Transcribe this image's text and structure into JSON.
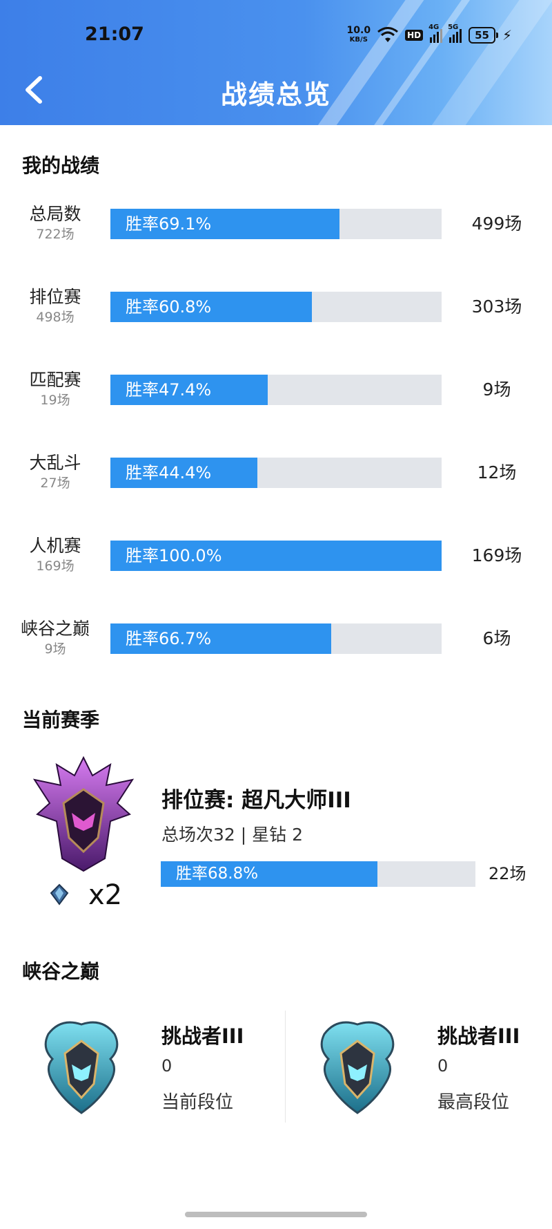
{
  "status_bar": {
    "time": "21:07",
    "net_speed": "10.0",
    "net_unit": "KB/S",
    "hd": "HD",
    "net1": "4G",
    "net2": "5G",
    "battery": "55"
  },
  "header": {
    "title": "战绩总览"
  },
  "my_stats": {
    "title": "我的战绩",
    "rows": [
      {
        "mode": "总局数",
        "games": "722场",
        "win_rate_label": "胜率69.1%",
        "win_rate": 69.1,
        "wins": "499场"
      },
      {
        "mode": "排位赛",
        "games": "498场",
        "win_rate_label": "胜率60.8%",
        "win_rate": 60.8,
        "wins": "303场"
      },
      {
        "mode": "匹配赛",
        "games": "19场",
        "win_rate_label": "胜率47.4%",
        "win_rate": 47.4,
        "wins": "9场"
      },
      {
        "mode": "大乱斗",
        "games": "27场",
        "win_rate_label": "胜率44.4%",
        "win_rate": 44.4,
        "wins": "12场"
      },
      {
        "mode": "人机赛",
        "games": "169场",
        "win_rate_label": "胜率100.0%",
        "win_rate": 100.0,
        "wins": "169场"
      },
      {
        "mode": "峡谷之巅",
        "games": "9场",
        "win_rate_label": "胜率66.7%",
        "win_rate": 66.7,
        "wins": "6场"
      }
    ]
  },
  "current_season": {
    "title": "当前赛季",
    "rank": "排位赛: 超凡大师III",
    "summary": "总场次32 | 星钻 2",
    "win_rate_label": "胜率68.8%",
    "win_rate": 68.8,
    "wins": "22场",
    "star_count": "x2"
  },
  "peak": {
    "title": "峡谷之巅",
    "cards": [
      {
        "rank": "挑战者III",
        "points": "0",
        "label": "当前段位"
      },
      {
        "rank": "挑战者III",
        "points": "0",
        "label": "最高段位"
      }
    ]
  },
  "colors": {
    "accent": "#2e93ef",
    "track": "#e2e5ea",
    "header": "#3d7fe8"
  }
}
